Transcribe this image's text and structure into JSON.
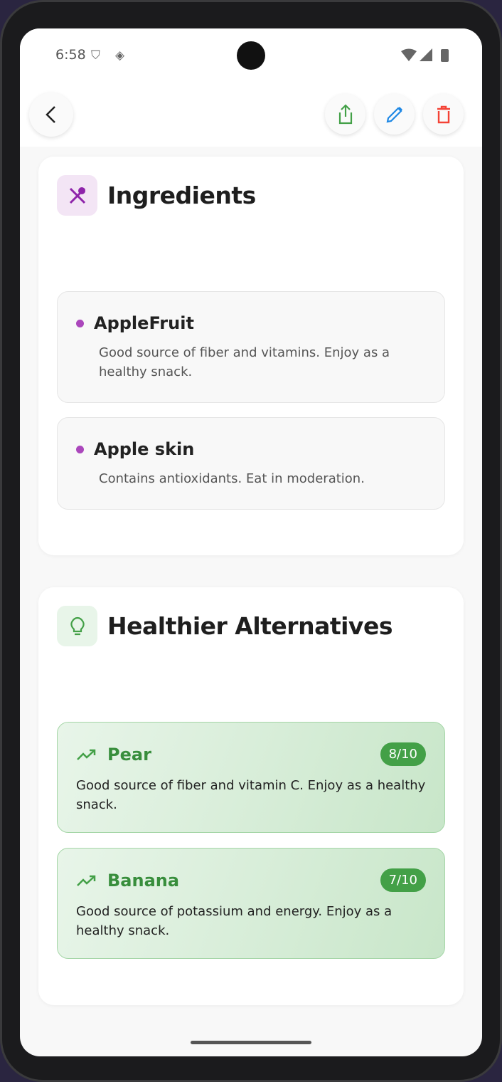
{
  "status_bar": {
    "time": "6:58",
    "icons": [
      "shield-icon",
      "vpn-icon",
      "wifi-icon",
      "signal-icon",
      "battery-icon"
    ]
  },
  "app_bar": {
    "actions": [
      "back",
      "share",
      "edit",
      "delete"
    ],
    "colors": {
      "share": "#43a047",
      "edit": "#1e88e5",
      "delete": "#f44336"
    }
  },
  "ingredients": {
    "title": "Ingredients",
    "items": [
      {
        "name": "AppleFruit",
        "description": "Good source of fiber and vitamins. Enjoy as a healthy snack."
      },
      {
        "name": "Apple skin",
        "description": "Contains antioxidants. Eat in moderation."
      }
    ]
  },
  "alternatives": {
    "title": "Healthier Alternatives",
    "items": [
      {
        "name": "Pear",
        "score": "8/10",
        "description": "Good source of fiber and vitamin C. Enjoy as a healthy snack."
      },
      {
        "name": "Banana",
        "score": "7/10",
        "description": "Good source of potassium and energy. Enjoy as a healthy snack."
      }
    ]
  }
}
